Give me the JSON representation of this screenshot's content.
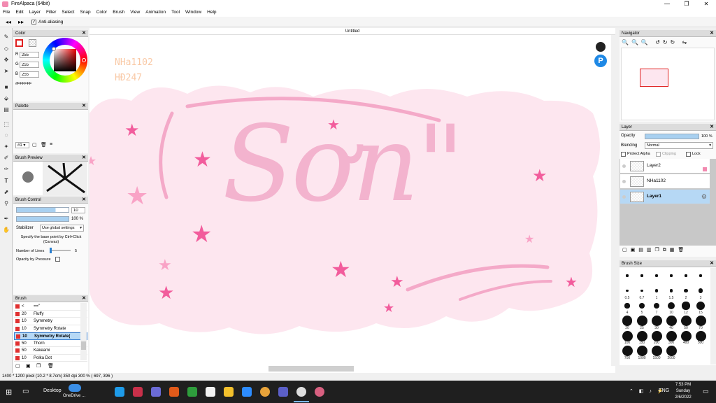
{
  "window": {
    "title": "FireAlpaca (64bit)",
    "min": "—",
    "max": "❐",
    "close": "✕"
  },
  "menu": [
    "File",
    "Edit",
    "Layer",
    "Filter",
    "Select",
    "Snap",
    "Color",
    "Brush",
    "View",
    "Animation",
    "Tool",
    "Window",
    "Help"
  ],
  "toolbar": {
    "antialias_label": "Anti-aliasing"
  },
  "color_panel": {
    "title": "Color",
    "r_label": "R",
    "g_label": "G",
    "b_label": "B",
    "r": "255",
    "g": "255",
    "b": "255",
    "hex": "#FFFFFF"
  },
  "palette_panel": {
    "title": "Palette",
    "selector": "#1"
  },
  "brush_preview": {
    "title": "Brush Preview"
  },
  "brush_control": {
    "title": "Brush Control",
    "size": "10",
    "opacity": "100 %",
    "opacity_pct": 100,
    "size_pct": 75,
    "stabilizer_label": "Stabilizer",
    "stabilizer_value": "Use global settings",
    "hint": "Specify the base point by Ctrl+Click (Canvas)",
    "lines_label": "Number of Lines",
    "lines_value": "5",
    "pressure_label": "Opacity by Pressure"
  },
  "brush_panel": {
    "title": "Brush",
    "items": [
      {
        "size": "<",
        "name": "==\""
      },
      {
        "size": "20",
        "name": "Fluffy"
      },
      {
        "size": "10",
        "name": "Symmetry"
      },
      {
        "size": "10",
        "name": "Symmetry Rotate"
      },
      {
        "size": "10",
        "name": "Symmetry Rotate(",
        "selected": true
      },
      {
        "size": "50",
        "name": "Thorn"
      },
      {
        "size": "50",
        "name": "Kakeami"
      },
      {
        "size": "10",
        "name": "Polka Dot"
      }
    ]
  },
  "canvas": {
    "tab": "Untitled",
    "watermark1": "NHa1102",
    "watermark2": "HĐ247",
    "art_text": "Sơn\""
  },
  "navigator": {
    "title": "Navigator"
  },
  "layer_panel": {
    "title": "Layer",
    "opacity_label": "Opacity",
    "opacity_value": "100 %",
    "blending_label": "Blending",
    "blending_value": "Normal",
    "protect_alpha": "Protect Alpha",
    "clipping": "Clipping",
    "lock": "Lock",
    "layers": [
      {
        "name": "Layer2"
      },
      {
        "name": "NHa1102"
      },
      {
        "name": "Layer1",
        "selected": true
      }
    ]
  },
  "brush_size": {
    "title": "Brush Size",
    "sizes": [
      "",
      "",
      "",
      "",
      "",
      "",
      "0.5",
      "0.7",
      "1",
      "1.5",
      "2",
      "3",
      "4",
      "5",
      "7",
      "10",
      "12",
      "15",
      "20",
      "25",
      "30",
      "40",
      "50",
      "70",
      "100",
      "150",
      "200",
      "300",
      "400",
      "500",
      "700",
      "1000",
      "1500",
      "2000"
    ]
  },
  "status": {
    "text": "1400 * 1200 pixel  (10.2 * 8.7cm)  350 dpi  300 %  ( 697, 396 )"
  },
  "taskbar": {
    "desktop": "Desktop",
    "onedrive": "OneDrive ...",
    "lang": "ENG",
    "time": "7:53 PM",
    "day": "Sunday",
    "date": "2/6/2022"
  },
  "colors": {
    "pink_dark": "#f25c9c",
    "pink_mid": "#f4a9c8",
    "pink_light": "#fde6ef",
    "accent": "#a8d0f0"
  }
}
